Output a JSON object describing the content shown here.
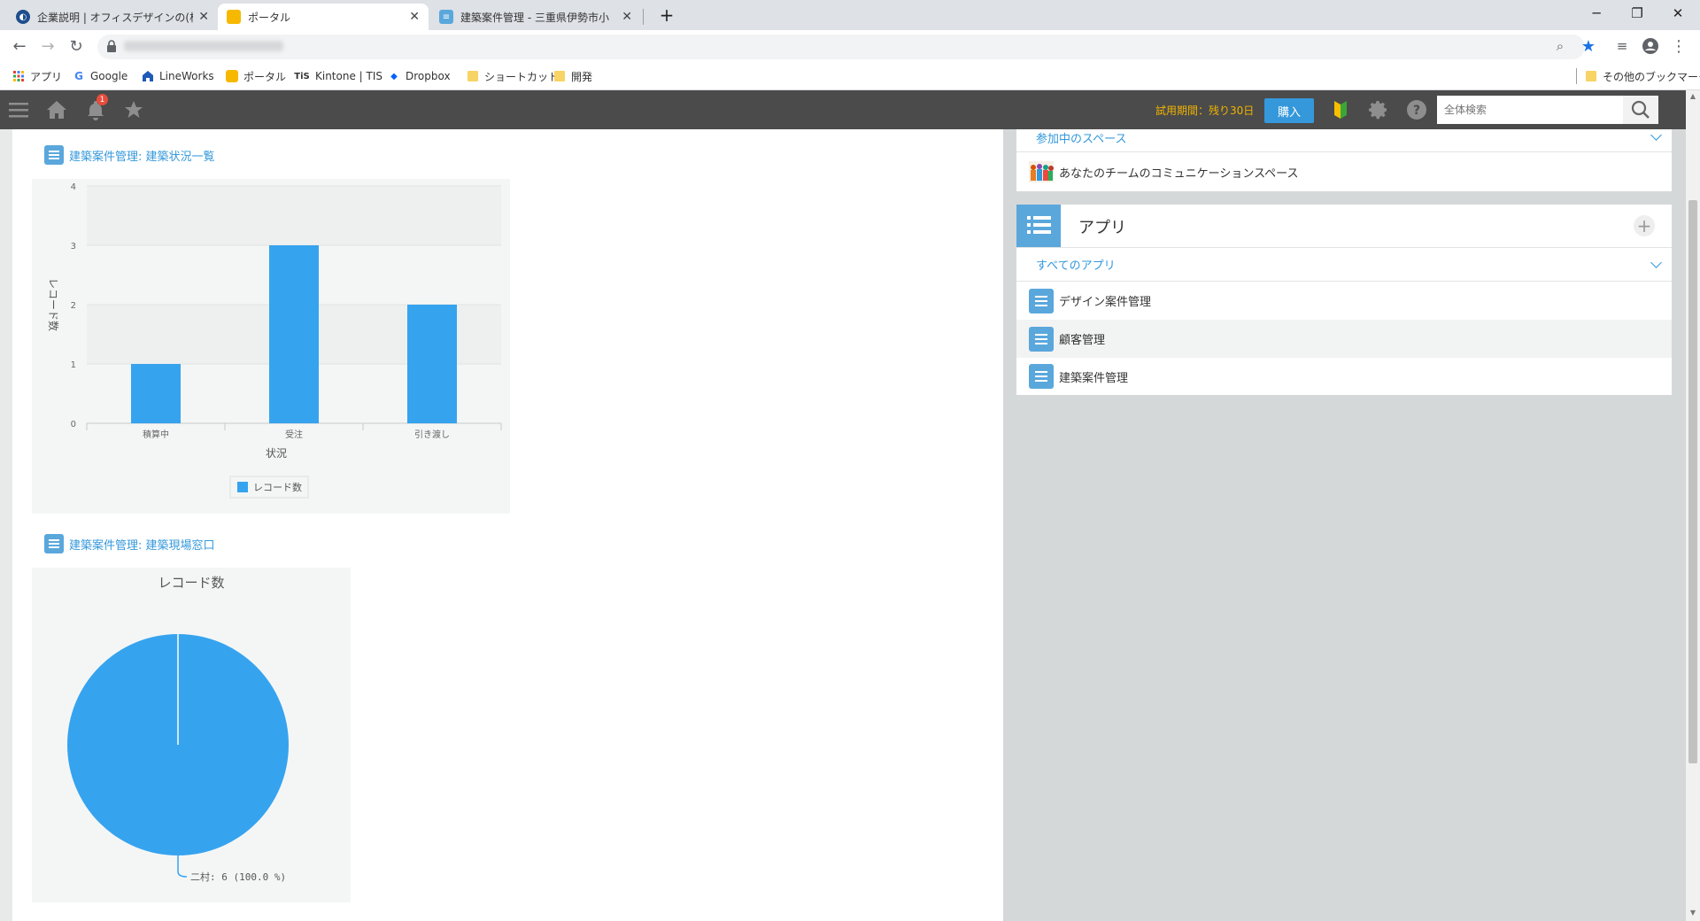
{
  "browser": {
    "tabs": [
      {
        "title": "企業説明 | オフィスデザインの(株)ステ",
        "active": false
      },
      {
        "title": "ポータル",
        "active": true
      },
      {
        "title": "建築案件管理 - 三重県伊勢市小",
        "active": false
      }
    ],
    "bookmarks": [
      {
        "label": "アプリ",
        "icon": "apps-grid-icon"
      },
      {
        "label": "Google",
        "icon": "google-icon"
      },
      {
        "label": "LineWorks",
        "icon": "home-icon"
      },
      {
        "label": "ポータル",
        "icon": "portal-icon"
      },
      {
        "label": "Kintone | TIS",
        "icon": "tis-icon",
        "prefix": "TiS"
      },
      {
        "label": "Dropbox",
        "icon": "dropbox-icon"
      },
      {
        "label": "ショートカット",
        "icon": "folder-icon"
      },
      {
        "label": "開発",
        "icon": "folder-icon"
      }
    ],
    "other_bookmarks": "その他のブックマーク"
  },
  "header": {
    "notification_count": "1",
    "trial_text": "試用期間：残り30日",
    "buy_label": "購入",
    "search_placeholder": "全体検索"
  },
  "widgets": {
    "bar_title": "建築案件管理: 建築状況一覧",
    "pie_title": "建築案件管理: 建築現場窓口"
  },
  "chart_data": [
    {
      "type": "bar",
      "categories": [
        "積算中",
        "受注",
        "引き渡し"
      ],
      "series": [
        {
          "name": "レコード数",
          "values": [
            1,
            3,
            2
          ]
        }
      ],
      "xlabel": "状況",
      "ylabel": "レコード数",
      "ylim": [
        0,
        4
      ],
      "yticks": [
        "0",
        "1",
        "2",
        "3",
        "4"
      ],
      "legend": "bottom",
      "color": "#36a3ef"
    },
    {
      "type": "pie",
      "title": "レコード数",
      "slices": [
        {
          "label": "二村",
          "value": 6,
          "percent": 100.0
        }
      ],
      "data_label": "二村: 6 (100.0 %)",
      "color": "#36a3ef"
    }
  ],
  "spaces": {
    "header": "参加中のスペース",
    "items": [
      "あなたのチームのコミュニケーションスペース"
    ]
  },
  "apps": {
    "title": "アプリ",
    "subheader": "すべてのアプリ",
    "items": [
      "デザイン案件管理",
      "顧客管理",
      "建築案件管理"
    ]
  }
}
